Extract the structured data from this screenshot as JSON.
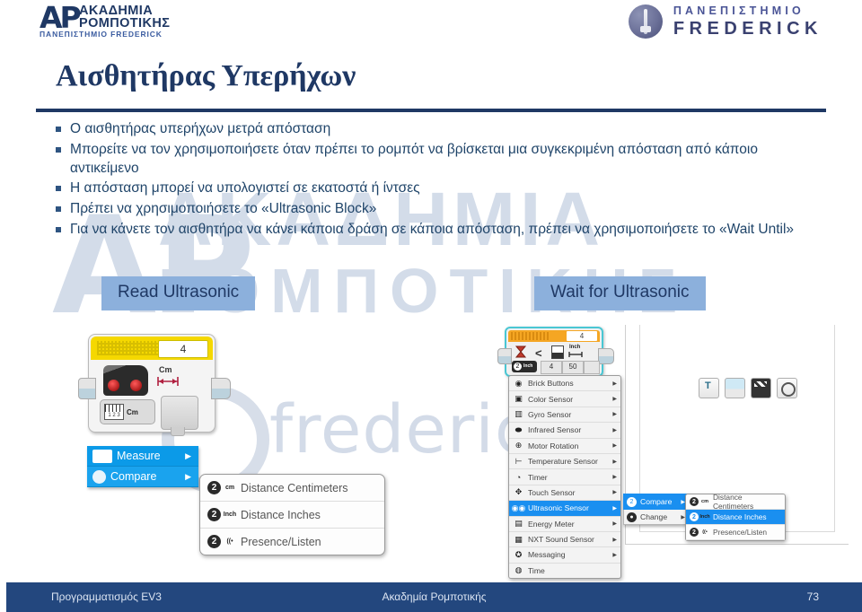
{
  "header": {
    "left_logo": {
      "mark": "ΑΡ",
      "line1": "ΑΚΑΔΗΜΙΑ",
      "line2": "ΡΟΜΠΟΤΙΚΗΣ",
      "line3": "ΠΑΝΕΠΙΣΤΗΜΙΟ FREDERICK"
    },
    "right_logo": {
      "line1": "ΠΑΝΕΠΙΣΤΗΜΙΟ",
      "line2": "FREDERICK"
    }
  },
  "slide": {
    "title": "Αισθητήρας Υπερήχων",
    "bullets": [
      "Ο αισθητήρας υπερήχων μετρά απόσταση",
      "Μπορείτε να τον χρησιμοποιήσετε όταν πρέπει το ρομπότ να βρίσκεται μια συγκεκριμένη απόσταση από κάποιο αντικείμενο",
      "Η απόσταση μπορεί να υπολογιστεί σε εκατοστά ή ίντσες",
      "Πρέπει να χρησιμοποιήσετε το «Ultrasonic Block»",
      "Για να κάνετε τον αισθητήρα να κάνει κάποια δράση σε κάποια απόσταση, πρέπει να χρησιμοποιήσετε το «Wait Until»"
    ],
    "captions": {
      "left": "Read Ultrasonic",
      "right": "Wait for Ultrasonic"
    },
    "watermark": {
      "line1": "ΑΚΑΔΗΜΙΑ",
      "line2": "ΡΟΜΠΟΤΙΚΗΣ",
      "mark": "ΑΡ",
      "frederick": "frederic"
    }
  },
  "ev3_measure_block": {
    "port": "4",
    "unit_label": "Cm",
    "mode_label": "Cm",
    "ruler_digits": "1 2 3"
  },
  "ev3_wait_block": {
    "port": "4",
    "operator": "<",
    "unit_label": "Inch",
    "value_a": "4",
    "value_b": "50",
    "mode_short": "Inch"
  },
  "blue_menu": {
    "items": [
      {
        "label": "Measure",
        "arrow": "▶",
        "icon": "ruler-icon"
      },
      {
        "label": "Compare",
        "arrow": "▶",
        "icon": "compare-icon"
      }
    ]
  },
  "distance_submenu_left": {
    "items": [
      {
        "label": "Distance Centimeters",
        "unit": "cm",
        "badge": "2"
      },
      {
        "label": "Distance Inches",
        "unit": "Inch",
        "badge": "2"
      },
      {
        "label": "Presence/Listen",
        "unit": "((•",
        "badge": "2"
      }
    ]
  },
  "sensor_list": {
    "items": [
      {
        "label": "Brick Buttons",
        "icon": "brick-buttons-icon",
        "arrow": "▶",
        "selected": false
      },
      {
        "label": "Color Sensor",
        "icon": "color-sensor-icon",
        "arrow": "▶",
        "selected": false
      },
      {
        "label": "Gyro Sensor",
        "icon": "gyro-sensor-icon",
        "arrow": "▶",
        "selected": false
      },
      {
        "label": "Infrared Sensor",
        "icon": "infrared-sensor-icon",
        "arrow": "▶",
        "selected": false
      },
      {
        "label": "Motor Rotation",
        "icon": "motor-rotation-icon",
        "arrow": "▶",
        "selected": false
      },
      {
        "label": "Temperature Sensor",
        "icon": "temperature-sensor-icon",
        "arrow": "▶",
        "selected": false
      },
      {
        "label": "Timer",
        "icon": "timer-icon",
        "arrow": "▶",
        "selected": false
      },
      {
        "label": "Touch Sensor",
        "icon": "touch-sensor-icon",
        "arrow": "▶",
        "selected": false
      },
      {
        "label": "Ultrasonic Sensor",
        "icon": "ultrasonic-sensor-icon",
        "arrow": "▶",
        "selected": true
      },
      {
        "label": "Energy Meter",
        "icon": "energy-meter-icon",
        "arrow": "▶",
        "selected": false
      },
      {
        "label": "NXT Sound Sensor",
        "icon": "nxt-sound-sensor-icon",
        "arrow": "▶",
        "selected": false
      },
      {
        "label": "Messaging",
        "icon": "messaging-icon",
        "arrow": "▶",
        "selected": false
      },
      {
        "label": "Time",
        "icon": "time-icon",
        "arrow": "",
        "selected": false
      }
    ]
  },
  "compare_change_menu": {
    "items": [
      {
        "label": "Compare",
        "arrow": "▶",
        "selected": true
      },
      {
        "label": "Change",
        "arrow": "▶",
        "selected": false
      }
    ]
  },
  "distance_submenu_right": {
    "items": [
      {
        "label": "Distance Centimeters",
        "unit": "cm",
        "badge": "2",
        "selected": false
      },
      {
        "label": "Distance Inches",
        "unit": "Inch",
        "badge": "2",
        "selected": true
      },
      {
        "label": "Presence/Listen",
        "unit": "((•",
        "badge": "2",
        "selected": false
      }
    ]
  },
  "toolbar_icons": [
    {
      "name": "text-tool-icon"
    },
    {
      "name": "image-tool-icon"
    },
    {
      "name": "video-tool-icon"
    },
    {
      "name": "sound-tool-icon"
    }
  ],
  "footer": {
    "left": "Προγραμματισμός EV3",
    "center": "Ακαδημία Ρομποτικής",
    "page": "73"
  },
  "colors": {
    "brand_dark_blue": "#1f3864",
    "footer_blue": "#23477e",
    "caption_blue": "#8cb0dc",
    "menu_blue": "#0b9ae8",
    "select_blue": "#1a8ff0",
    "ev3_yellow": "#f5d800",
    "ev3_orange": "#f5a623",
    "watermark_gray": "#ccd6e6"
  }
}
